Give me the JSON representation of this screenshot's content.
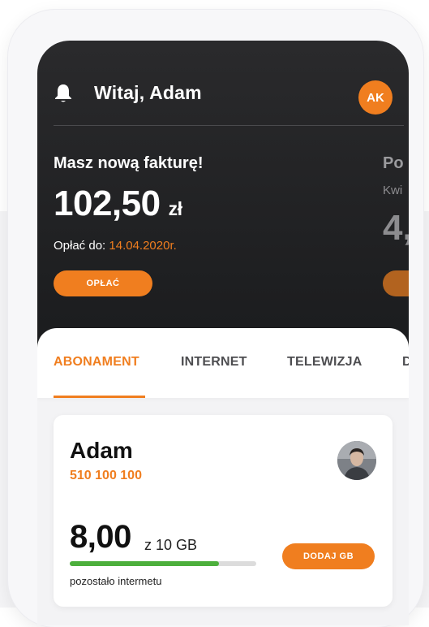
{
  "header": {
    "greeting": "Witaj, Adam",
    "avatar_initials": "AK"
  },
  "invoice_card": {
    "title": "Masz nową fakturę!",
    "amount": "102,50",
    "currency": "zł",
    "due_label": "Opłać do:",
    "due_date": "14.04.2020r.",
    "pay_button": "OPŁAĆ"
  },
  "next_card": {
    "title": "Po",
    "subtitle": "Kwi",
    "amount": "4,"
  },
  "tabs": [
    {
      "label": "ABONAMENT",
      "active": true
    },
    {
      "label": "INTERNET",
      "active": false
    },
    {
      "label": "TELEWIZJA",
      "active": false
    },
    {
      "label": "D",
      "active": false
    }
  ],
  "line_card": {
    "name": "Adam",
    "number": "510 100 100",
    "data_left": "8,00",
    "data_total": "z 10 GB",
    "usage_fraction": 0.8,
    "caption": "pozostało intermetu",
    "add_button": "DODAJ GB"
  },
  "colors": {
    "accent": "#f07e1f",
    "progress": "#4caf3c",
    "header_bg": "#1f2022"
  },
  "icons": {
    "notification": "bell-icon",
    "profile": "user-photo"
  }
}
